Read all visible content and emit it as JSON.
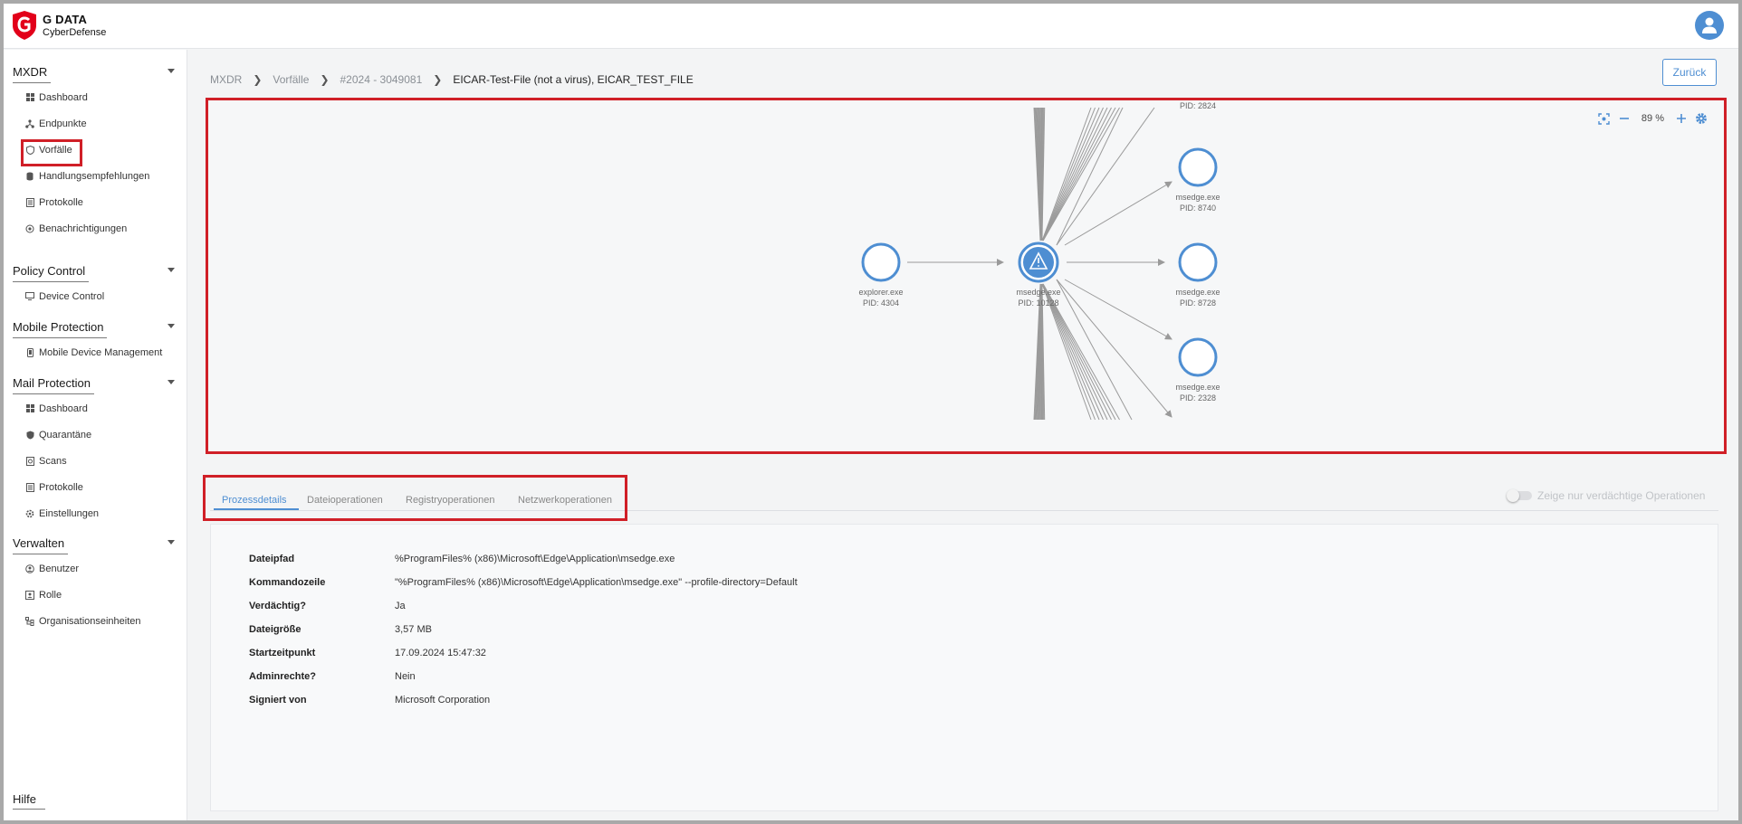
{
  "brand": {
    "title": "G DATA",
    "subtitle": "CyberDefense"
  },
  "sidebar": {
    "groups": [
      {
        "label": "MXDR",
        "items": [
          {
            "label": "Dashboard",
            "icon": "dashboard-icon"
          },
          {
            "label": "Endpunkte",
            "icon": "network-icon"
          },
          {
            "label": "Vorfälle",
            "icon": "shield-icon"
          },
          {
            "label": "Handlungsempfehlungen",
            "icon": "database-icon"
          },
          {
            "label": "Protokolle",
            "icon": "document-icon"
          },
          {
            "label": "Benachrichtigungen",
            "icon": "bell-icon"
          }
        ]
      },
      {
        "label": "Policy Control",
        "items": [
          {
            "label": "Device Control",
            "icon": "device-icon"
          }
        ]
      },
      {
        "label": "Mobile Protection",
        "items": [
          {
            "label": "Mobile Device Management",
            "icon": "phone-icon"
          }
        ]
      },
      {
        "label": "Mail Protection",
        "items": [
          {
            "label": "Dashboard",
            "icon": "dashboard-icon"
          },
          {
            "label": "Quarantäne",
            "icon": "shield-icon"
          },
          {
            "label": "Scans",
            "icon": "scan-icon"
          },
          {
            "label": "Protokolle",
            "icon": "document-icon"
          },
          {
            "label": "Einstellungen",
            "icon": "gear-icon"
          }
        ]
      },
      {
        "label": "Verwalten",
        "items": [
          {
            "label": "Benutzer",
            "icon": "user-icon"
          },
          {
            "label": "Rolle",
            "icon": "role-icon"
          },
          {
            "label": "Organisationseinheiten",
            "icon": "org-icon"
          }
        ]
      }
    ],
    "help": "Hilfe"
  },
  "breadcrumb": {
    "items": [
      "MXDR",
      "Vorfälle",
      "#2024 - 3049081"
    ],
    "current": "EICAR-Test-File (not a virus), EICAR_TEST_FILE"
  },
  "back_button": "Zurück",
  "graph": {
    "zoom": "89 %",
    "nodes": [
      {
        "name": "explorer.exe",
        "pid": "PID: 4304"
      },
      {
        "name": "msedge.exe",
        "pid": "PID: 10128",
        "alert": true
      },
      {
        "name": "msedge.exe",
        "pid": "PID: 8740"
      },
      {
        "name": "msedge.exe",
        "pid": "PID: 8728"
      },
      {
        "name": "msedge.exe",
        "pid": "PID: 2328"
      },
      {
        "name": "",
        "pid": "PID: 2824"
      }
    ]
  },
  "tabs": [
    "Prozessdetails",
    "Dateioperationen",
    "Registryoperationen",
    "Netzwerkoperationen"
  ],
  "toggle_label": "Zeige nur verdächtige Operationen",
  "details": [
    {
      "key": "Dateipfad",
      "value": "%ProgramFiles% (x86)\\Microsoft\\Edge\\Application\\msedge.exe"
    },
    {
      "key": "Kommandozeile",
      "value": "\"%ProgramFiles% (x86)\\Microsoft\\Edge\\Application\\msedge.exe\" --profile-directory=Default"
    },
    {
      "key": "Verdächtig?",
      "value": "Ja"
    },
    {
      "key": "Dateigröße",
      "value": "3,57 MB"
    },
    {
      "key": "Startzeitpunkt",
      "value": "17.09.2024 15:47:32"
    },
    {
      "key": "Adminrechte?",
      "value": "Nein"
    },
    {
      "key": "Signiert von",
      "value": "Microsoft Corporation"
    }
  ],
  "colors": {
    "accent": "#4e8ed2",
    "highlight": "#d01f27",
    "brand_red": "#e2001a"
  }
}
